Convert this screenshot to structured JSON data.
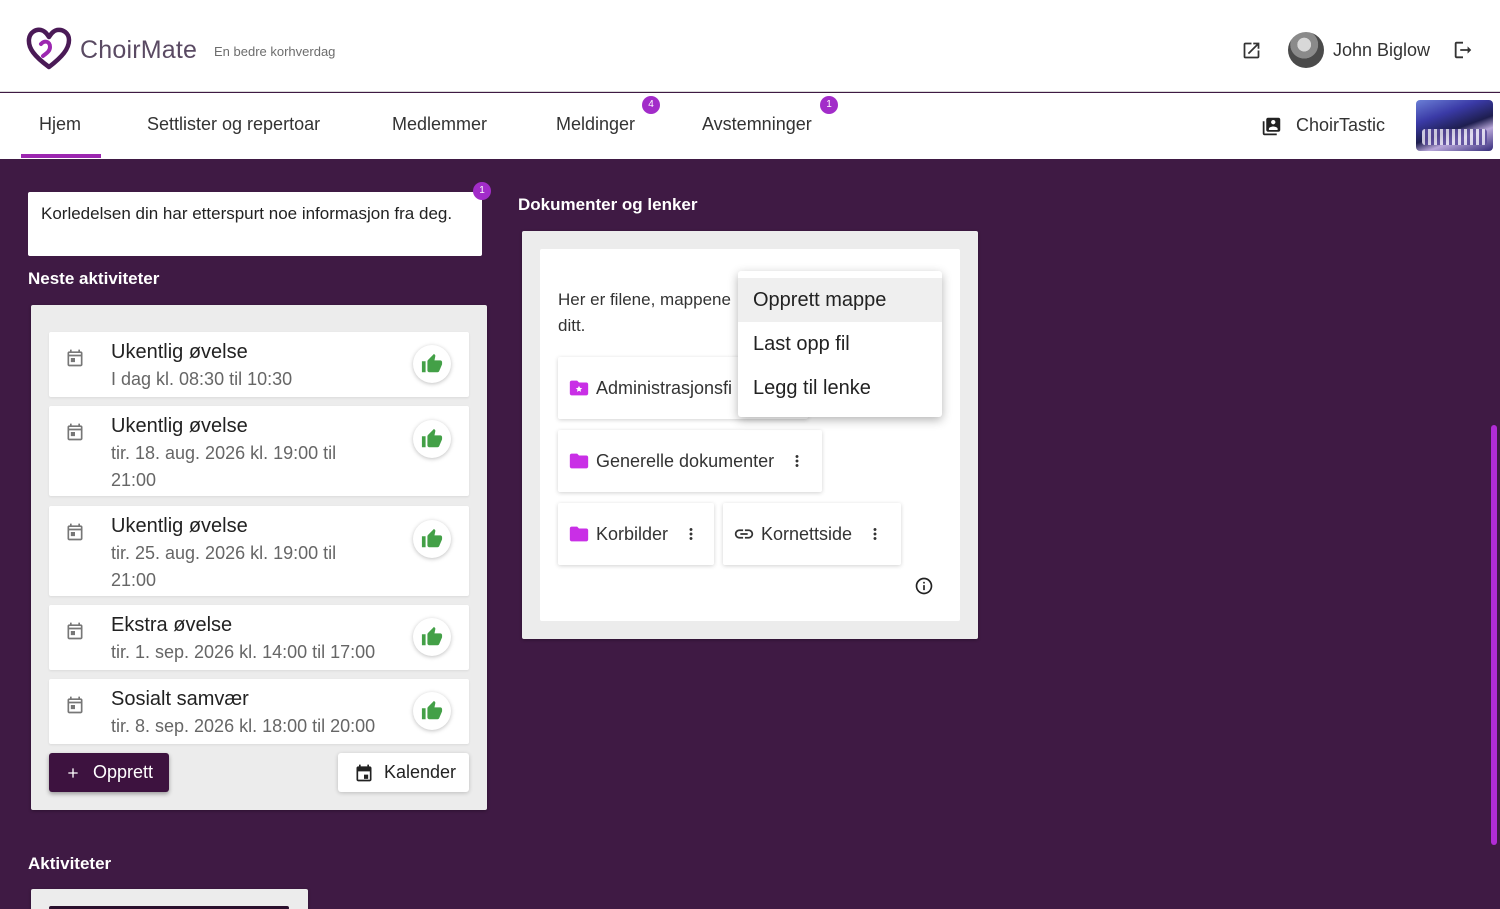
{
  "header": {
    "brand": "ChoirMate",
    "tagline": "En bedre korhverdag",
    "user_name": "John Biglow"
  },
  "tabs": [
    {
      "label": "Hjem",
      "active": true
    },
    {
      "label": "Settlister og repertoar"
    },
    {
      "label": "Medlemmer"
    },
    {
      "label": "Meldinger",
      "badge": "4"
    },
    {
      "label": "Avstemninger",
      "badge": "1"
    }
  ],
  "choir": {
    "name": "ChoirTastic"
  },
  "notice": {
    "text": "Korledelsen din har etterspurt noe informasjon fra deg.",
    "badge": "1"
  },
  "next_activities": {
    "title": "Neste aktiviteter",
    "items": [
      {
        "title": "Ukentlig øvelse",
        "time": "I dag kl. 08:30 til 10:30"
      },
      {
        "title": "Ukentlig øvelse",
        "time": "tir. 18. aug. 2026 kl. 19:00 til 21:00"
      },
      {
        "title": "Ukentlig øvelse",
        "time": "tir. 25. aug. 2026 kl. 19:00 til 21:00"
      },
      {
        "title": "Ekstra øvelse",
        "time": "tir. 1. sep. 2026 kl. 14:00 til 17:00"
      },
      {
        "title": "Sosialt samvær",
        "time": "tir. 8. sep. 2026 kl. 18:00 til 20:00"
      }
    ],
    "create_label": "Opprett",
    "calendar_label": "Kalender"
  },
  "documents": {
    "title": "Dokumenter og lenker",
    "intro": "Her er filene, mappene og lenkene til koret ditt.",
    "intro_visible": "Her er filene, mappene",
    "intro_visible_2": "ditt.",
    "entries": [
      {
        "label": "Administrasjonsfiler",
        "visible": "Administrasjonsfi",
        "type": "admin-folder"
      },
      {
        "label": "Generelle dokumenter",
        "type": "folder"
      },
      {
        "label": "Korbilder",
        "type": "folder"
      },
      {
        "label": "Kornettside",
        "type": "link"
      }
    ],
    "menu": [
      "Opprett mappe",
      "Last opp fil",
      "Legg til lenke"
    ]
  },
  "activities": {
    "title": "Aktiviteter"
  },
  "colors": {
    "brand_purple": "#9c27b0",
    "background": "#3f1a44",
    "like_green": "#43a047",
    "folder_magenta": "#c92fe6"
  }
}
